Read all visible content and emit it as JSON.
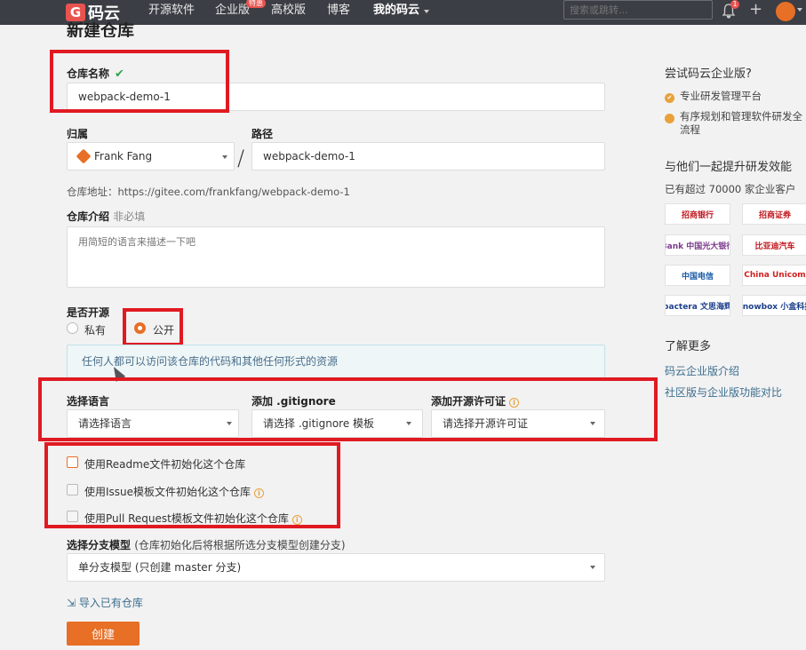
{
  "nav": {
    "logo_glyph": "G",
    "logo_text": "码云",
    "links": [
      "开源软件",
      "企业版",
      "高校版",
      "博客",
      "我的码云"
    ],
    "hot_badge": "特惠",
    "search_placeholder": "搜索或跳转...",
    "notify_count": "1",
    "plus": "+"
  },
  "page": {
    "title": "新建仓库"
  },
  "form": {
    "repo_name_label": "仓库名称",
    "repo_name_value": "webpack-demo-1",
    "owner_label": "归属",
    "owner_value": "Frank Fang",
    "path_label": "路径",
    "path_value": "webpack-demo-1",
    "slash": "/",
    "repo_url_prefix": "仓库地址：",
    "repo_url": "https://gitee.com/frankfang/webpack-demo-1",
    "intro_label": "仓库介绍",
    "intro_optional": "非必填",
    "intro_placeholder": "用简短的语言来描述一下吧",
    "open_source_label": "是否开源",
    "private_label": "私有",
    "public_label": "公开",
    "public_info": "任何人都可以访问该仓库的代码和其他任何形式的资源",
    "language_label": "选择语言",
    "language_value": "请选择语言",
    "gitignore_label": "添加 .gitignore",
    "gitignore_value": "请选择 .gitignore 模板",
    "license_label": "添加开源许可证",
    "license_value": "请选择开源许可证",
    "init_readme": "使用Readme文件初始化这个仓库",
    "init_issue": "使用Issue模板文件初始化这个仓库",
    "init_pr": "使用Pull Request模板文件初始化这个仓库",
    "branch_label": "选择分支模型",
    "branch_hint": "(仓库初始化后将根据所选分支模型创建分支)",
    "branch_value": "单分支模型 (只创建 master 分支)",
    "import_link": "导入已有仓库",
    "create_button": "创建"
  },
  "sidebar": {
    "try_title": "尝试码云企业版?",
    "feature_1": "专业研发管理平台",
    "feature_2": "有序规划和管理软件研发全流程",
    "together_title": "与他们一起提升研发效能",
    "customers": "已有超过 70000 家企业客户",
    "logos": [
      "招商银行",
      "招商证券",
      "Bank 中国光大银行",
      "比亚迪汽车",
      "中国电信",
      "China Unicom",
      "pactera 文思海辉",
      "knowbox 小盒科技"
    ],
    "more_title": "了解更多",
    "link_1": "码云企业版介绍",
    "link_2": "社区版与企业版功能对比"
  },
  "colors": {
    "accent": "#e76f26",
    "nav_bg": "#3b3e45",
    "highlight": "#e01a22"
  }
}
